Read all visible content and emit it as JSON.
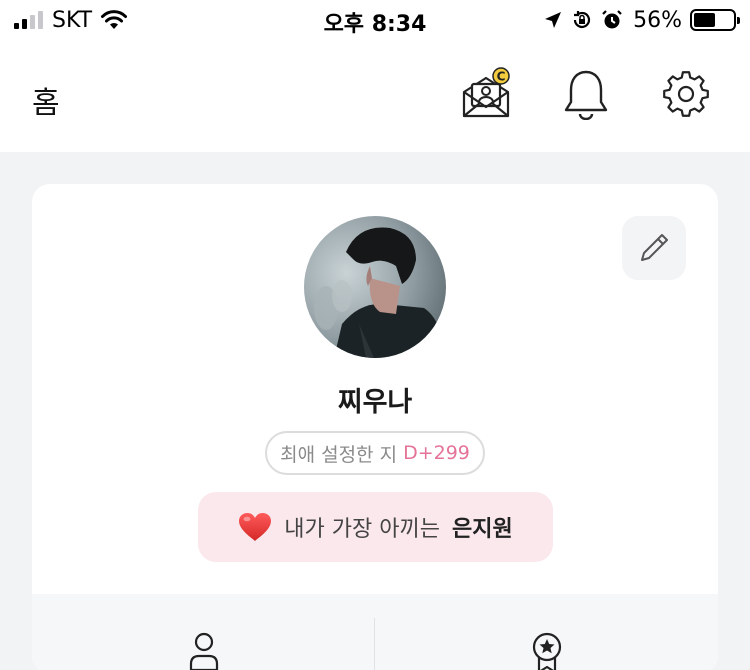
{
  "status_bar": {
    "carrier": "SKT",
    "time": "오후 8:34",
    "battery_percent": "56%",
    "battery_level": 0.56,
    "signal_bars_active": 2,
    "signal_bars_total": 4
  },
  "header": {
    "title": "홈",
    "icons": [
      "mail-coin-icon",
      "bell-icon",
      "gear-icon"
    ]
  },
  "profile": {
    "nickname": "찌우나",
    "dday_label": "최애 설정한 지",
    "dday_value": "D+299",
    "favorite_emoji": "❤️",
    "favorite_text": "내가 가장 아끼는",
    "favorite_name": "은지원",
    "edit_icon": "pencil-icon"
  },
  "menu": {
    "items": [
      {
        "icon": "person-icon"
      },
      {
        "icon": "badge-icon"
      }
    ]
  },
  "colors": {
    "accent_pink": "#e57398",
    "banner_bg": "#fbe8ec",
    "page_bg": "#f2f3f5",
    "coin_badge": "#f2cc3c"
  }
}
